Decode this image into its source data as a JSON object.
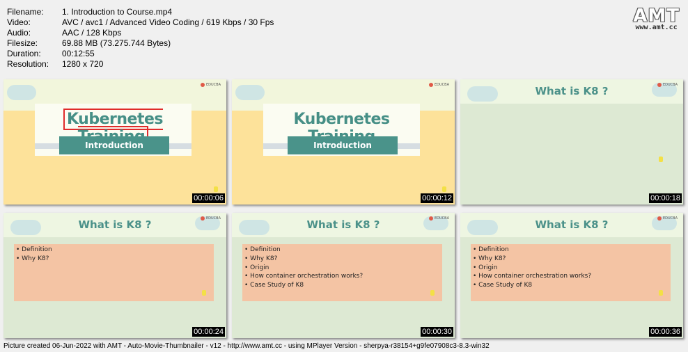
{
  "info": [
    {
      "key": "Filename:",
      "value": "1. Introduction to Course.mp4"
    },
    {
      "key": "Video:",
      "value": "AVC / avc1 / Advanced Video Coding / 619 Kbps / 30 Fps"
    },
    {
      "key": "Audio:",
      "value": "AAC / 128 Kbps"
    },
    {
      "key": "Filesize:",
      "value": "69.88 MB (73.275.744 Bytes)"
    },
    {
      "key": "Duration:",
      "value": "00:12:55"
    },
    {
      "key": "Resolution:",
      "value": "1280 x 720"
    }
  ],
  "logo": {
    "text": "AMT",
    "url": "www.amt.cc"
  },
  "brand": "EDUCBA",
  "title_slide": {
    "heading": "Kubernetes Training",
    "button": "Introduction"
  },
  "content_title": "What is K8 ?",
  "thumbs": [
    {
      "time": "00:00:06"
    },
    {
      "time": "00:00:12"
    },
    {
      "time": "00:00:18"
    },
    {
      "time": "00:00:24",
      "bullets": [
        "Definition",
        "Why K8?"
      ]
    },
    {
      "time": "00:00:30",
      "bullets": [
        "Definition",
        "Why K8?",
        "Origin",
        "How container orchestration works?",
        "Case Study of K8"
      ]
    },
    {
      "time": "00:00:36",
      "bullets": [
        "Definition",
        "Why K8?",
        "Origin",
        "How container orchestration works?",
        "Case Study of K8"
      ]
    }
  ],
  "footer": "Picture created 06-Jun-2022 with AMT - Auto-Movie-Thumbnailer - v12 - http://www.amt.cc - using MPlayer Version - sherpya-r38154+g9fe07908c3-8.3-win32",
  "colors": {
    "accent": "#468f86",
    "title_band": "#fde29a",
    "content_bg": "#dde9d3",
    "bullet_box": "#f4c4a4"
  }
}
